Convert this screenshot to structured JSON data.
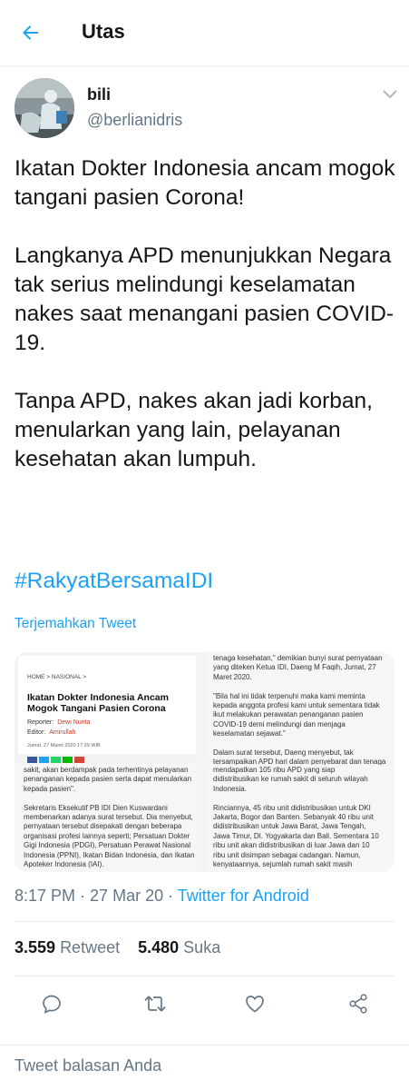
{
  "header": {
    "title": "Utas",
    "back_icon": "arrow-left-icon"
  },
  "author": {
    "name": "bili",
    "handle": "@berlianidris"
  },
  "tweet": {
    "paragraphs": [
      "Ikatan Dokter Indonesia ancam mogok tangani pasien Corona!",
      "Langkanya APD menunjukkan Negara tak serius melindungi keselamatan nakes saat menangani pasien COVID-19.",
      "Tanpa APD, nakes akan jadi korban, menularkan yang lain, pelayanan kesehatan akan lumpuh."
    ],
    "hashtag": "#RakyatBersamaIDI",
    "translate": "Terjemahkan Tweet"
  },
  "media": {
    "article": {
      "breadcrumb": "HOME  >  NASIONAL  >",
      "headline": "Ikatan Dokter Indonesia Ancam Mogok Tangani Pasien Corona",
      "reporter_label": "Reporter:",
      "reporter": "Dewi Nurita",
      "editor_label": "Editor:",
      "editor": "Amirullah",
      "date": "Jumat, 27 Maret 2020 17:39 WIB"
    },
    "top_right": {
      "lines": [
        "tenaga kesehatan,\" demikian bunyi surat pernyataan",
        "yang diteken Ketua IDI, Daeng M Faqih, Jumat, 27",
        "Maret 2020.",
        "",
        "\"Bila hal ini tidak terpenuhi maka kami meminta",
        "kepada anggota profesi kami untuk sementara tidak",
        "ikut melakukan perawatan penanganan pasien",
        "COVID-19 demi melindungi dan menjaga",
        "keselamatan sejawat.\"",
        "",
        "Dalam surat tersebut, Daeng menyebut, tak",
        "tersampaikan APD hari dalam penyebarat dan tenaga"
      ]
    },
    "bottom_left": {
      "lines": [
        "sakit, akan berdampak pada terhentinya pelayanan",
        "penanganan kepada pasien serta dapat menularkan",
        "kepada pasien\".",
        "",
        "Sekretaris Eksekutif PB IDI Dien Kuswardani",
        "membenarkan adanya surat tersebut. Dia menyebut,",
        "pernyataan tersebut disepakati dengan beberapa",
        "organisasi profesi lainnya seperti; Persatuan Dokter",
        "Gigi Indonesia (PDGI), Persatuan Perawat Nasional",
        "Indonesia (PPNI), Ikatan Bidan Indonesia, dan Ikatan",
        "Apoteker Indonesia (IAI)."
      ]
    },
    "bottom_right": {
      "lines": [
        "mendapatkan 105 ribu APD yang siap",
        "didistribusikan ke rumah sakit di seluruh wilayah",
        "Indonesia.",
        "",
        "Rinciannya, 45 ribu unit didistribusikan untuk DKI",
        "Jakarta, Bogor dan Banten. Sebanyak 40 ribu unit",
        "didistribusikan untuk Jawa Barat, Jawa Tengah,",
        "Jawa Timur, DI. Yogyakarta dan Bali. Sementara 10",
        "ribu unit akan didistribusikan di luar Jawa dan 10",
        "ribu unit disimpan sebagai cadangan. Namun,",
        "kenyataannya, sejumlah rumah sakit masih"
      ]
    }
  },
  "meta": {
    "time": "8:17 PM",
    "separator": " · ",
    "date": "27 Mar 20",
    "source": "Twitter for Android"
  },
  "stats": {
    "retweets": "3.559",
    "retweets_label": "Retweet",
    "likes": "5.480",
    "likes_label": "Suka"
  },
  "actions": [
    "reply-icon",
    "retweet-icon",
    "like-icon",
    "share-icon"
  ],
  "reply": {
    "placeholder": "Tweet balasan Anda"
  },
  "colors": {
    "accent": "#1da1f2",
    "text": "#14171a",
    "muted": "#657786",
    "border": "#e6ecf0"
  }
}
